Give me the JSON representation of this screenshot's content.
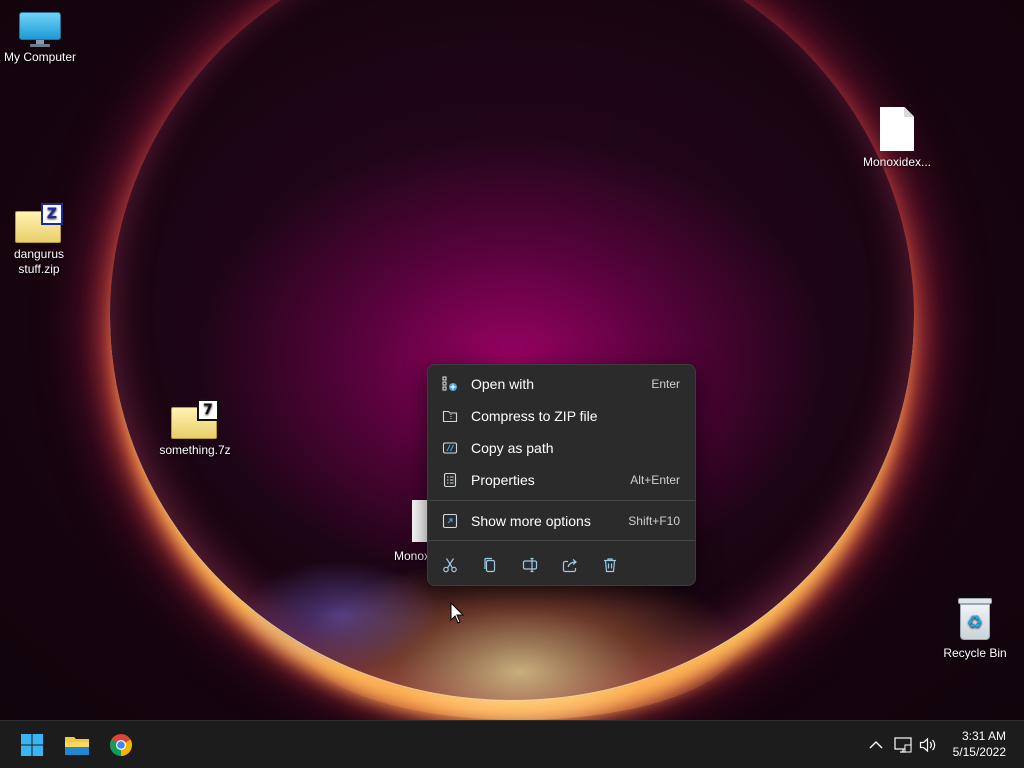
{
  "desktop": {
    "icons": {
      "my_computer": "My Computer",
      "dangurus_zip_line1": "dangurus",
      "dangurus_zip_line2": "stuff.zip",
      "something_7z": "something.7z",
      "monoxidex": "Monoxidex...",
      "monox_partial": "Monox",
      "recycle_bin": "Recycle Bin"
    },
    "badges": {
      "zip": "Z",
      "sevenzip": "7"
    }
  },
  "context_menu": {
    "items": [
      {
        "label": "Open with",
        "shortcut": "Enter",
        "icon": "open-with-icon"
      },
      {
        "label": "Compress to ZIP file",
        "shortcut": "",
        "icon": "zip-icon"
      },
      {
        "label": "Copy as path",
        "shortcut": "",
        "icon": "copy-path-icon"
      },
      {
        "label": "Properties",
        "shortcut": "Alt+Enter",
        "icon": "properties-icon"
      },
      {
        "label": "Show more options",
        "shortcut": "Shift+F10",
        "icon": "more-options-icon"
      }
    ],
    "actions": [
      "cut-icon",
      "copy-icon",
      "rename-icon",
      "share-icon",
      "delete-icon"
    ]
  },
  "taskbar": {
    "apps": [
      "start-icon",
      "file-explorer-icon",
      "chrome-icon"
    ],
    "tray": [
      "chevron-up-icon",
      "network-icon",
      "volume-icon"
    ],
    "clock": {
      "time": "3:31 AM",
      "date": "5/15/2022"
    }
  },
  "colors": {
    "accent": "#9ccbe6",
    "menu_bg": "#2b2b2b",
    "taskbar_bg": "#1c1c1c"
  }
}
